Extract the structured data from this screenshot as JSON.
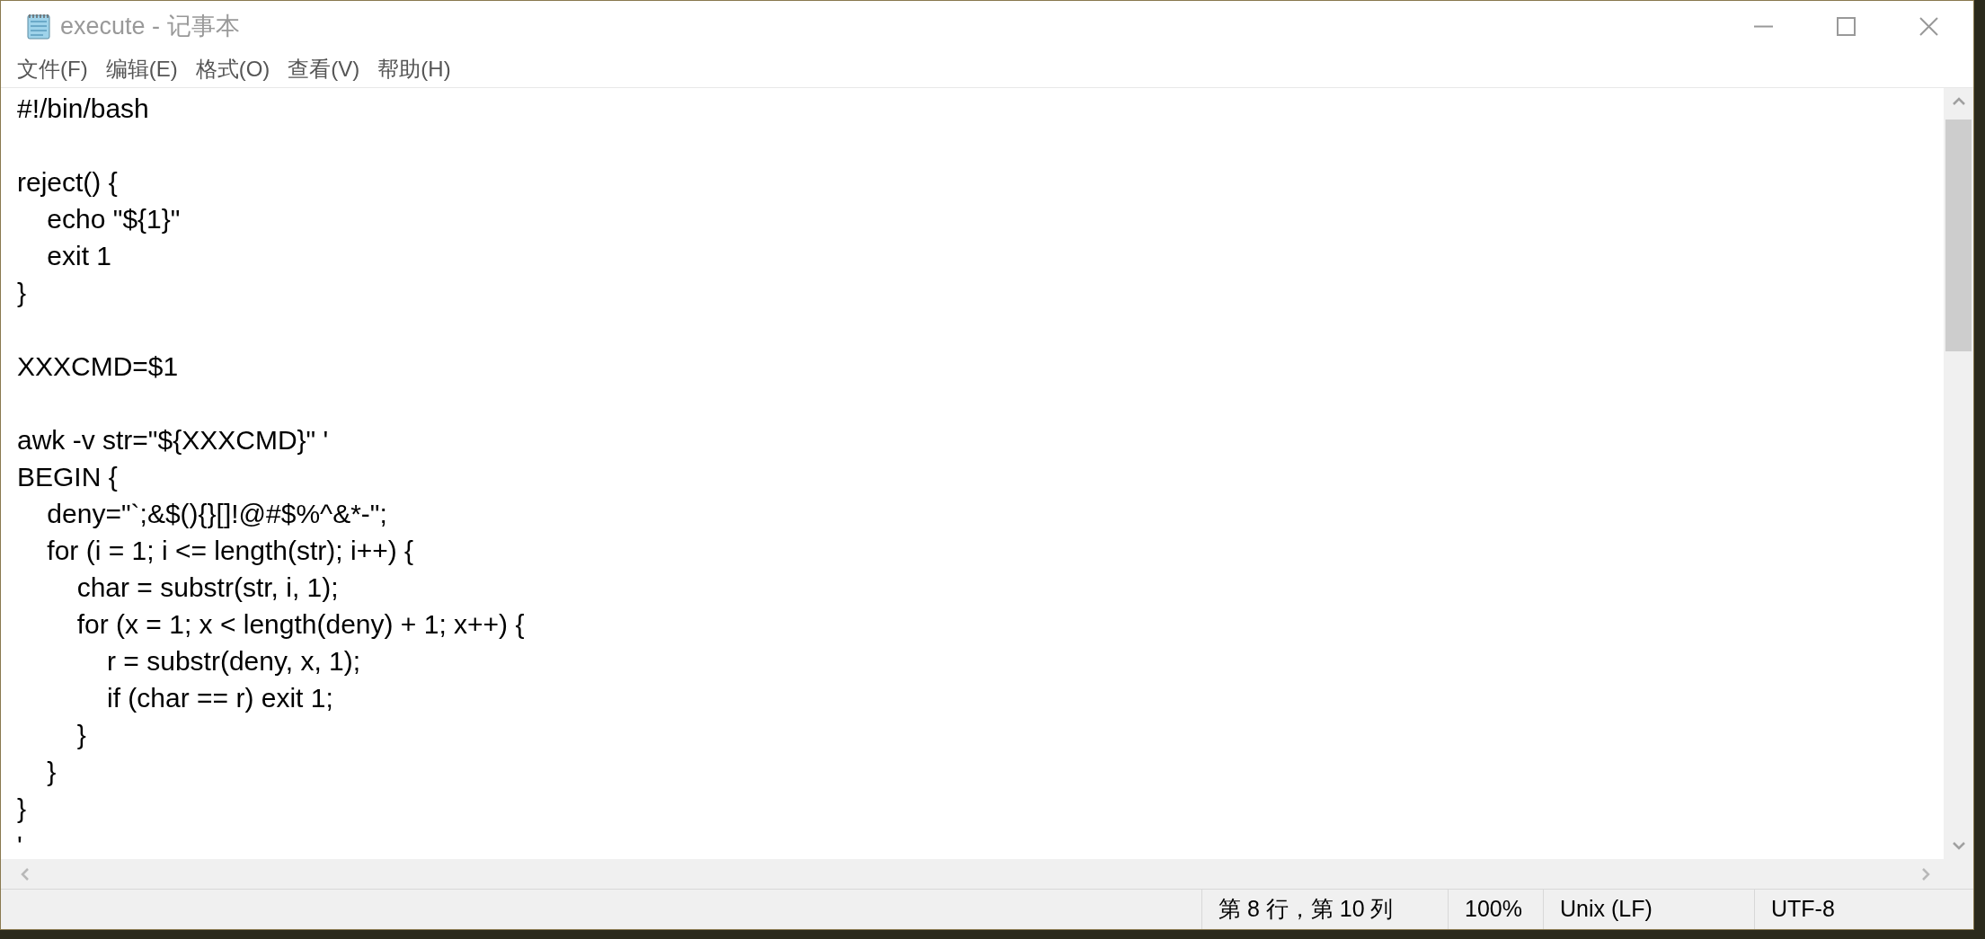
{
  "window": {
    "title": "execute - 记事本"
  },
  "menu": [
    "文件(F)",
    "编辑(E)",
    "格式(O)",
    "查看(V)",
    "帮助(H)"
  ],
  "editor": {
    "content": "#!/bin/bash\n\nreject() {\n    echo \"${1}\"\n    exit 1\n}\n\nXXXCMD=$1\n\nawk -v str=\"${XXXCMD}\" '\nBEGIN {\n    deny=\"`;&$(){}[]!@#$%^&*-\";\n    for (i = 1; i <= length(str); i++) {\n        char = substr(str, i, 1);\n        for (x = 1; x < length(deny) + 1; x++) {\n            r = substr(deny, x, 1);\n            if (char == r) exit 1;\n        }\n    }\n}\n'"
  },
  "status_bar": {
    "position": "第 8 行，第 10 列",
    "zoom": "100%",
    "line_ending": "Unix (LF)",
    "encoding": "UTF-8"
  }
}
